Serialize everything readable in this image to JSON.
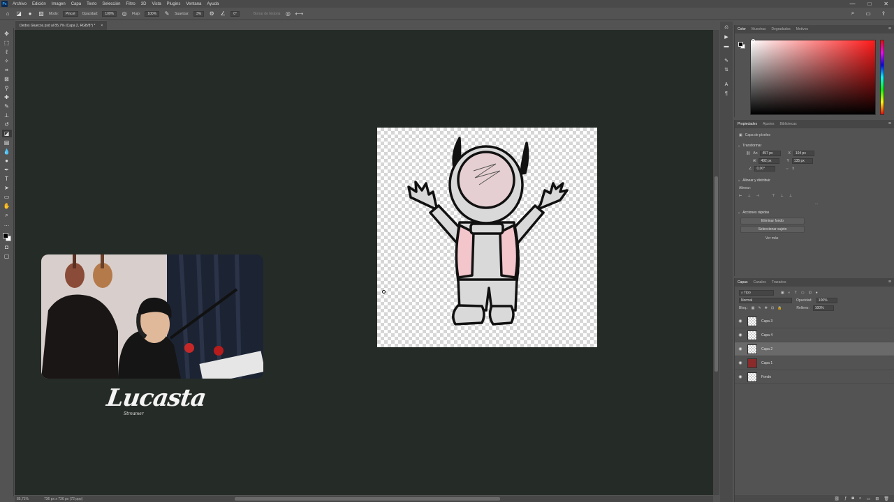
{
  "app": {
    "logo": "Ps"
  },
  "menu": [
    "Archivo",
    "Edición",
    "Imagen",
    "Capa",
    "Texto",
    "Selección",
    "Filtro",
    "3D",
    "Vista",
    "Plugins",
    "Ventana",
    "Ayuda"
  ],
  "window_controls": {
    "minimize": "—",
    "maximize": "□",
    "close": "✕"
  },
  "options": {
    "mode_label": "Modo:",
    "mode_value": "Pincel",
    "opacity_label": "Opacidad:",
    "opacity_value": "100%",
    "flow_label": "Flujo:",
    "flow_value": "100%",
    "smooth_label": "Suavizar:",
    "smooth_value": "3%",
    "angle_value": "0°",
    "erase_history": "Borrar de historia"
  },
  "document": {
    "tab_title": "Dedos Gluecos.psd al 85,7% (Capa 2, RGB/8*) *",
    "close": "×"
  },
  "statusbar": {
    "zoom": "85,71%",
    "dimensions": "736 px x 736 px (72 ppp)"
  },
  "overlay": {
    "brand": "Lucasta",
    "brand_sub": "Streamer"
  },
  "color_panel": {
    "tabs": [
      "Color",
      "Muestras",
      "Degradados",
      "Motivos"
    ]
  },
  "properties_panel": {
    "tabs": [
      "Propiedades",
      "Ajustes",
      "Bibliotecas"
    ],
    "layer_type": "Capa de píxeles",
    "transform_title": "Transformar",
    "w_label": "An",
    "w_value": "457 px",
    "h_label": "Al",
    "h_value": "492 px",
    "x_label": "X",
    "x_value": "104 px",
    "y_label": "Y",
    "y_value": "135 px",
    "angle_value": "0,00°",
    "align_title": "Alinear y distribuir",
    "align_sub": "Alinear:",
    "quick_title": "Acciones rápidas",
    "quick_btn1": "Eliminar fondo",
    "quick_btn2": "Seleccionar sujeto",
    "more": "Ver más"
  },
  "layers_panel": {
    "tabs": [
      "Capas",
      "Canales",
      "Trazados"
    ],
    "filter": "Tipo",
    "blend": "Normal",
    "opacity_label": "Opacidad:",
    "opacity_value": "100%",
    "lock_label": "Bloq.:",
    "fill_label": "Relleno:",
    "fill_value": "100%",
    "layers": [
      "Capa 3",
      "Capa 4",
      "Capa 2",
      "Capa 1",
      "Fondo"
    ]
  }
}
